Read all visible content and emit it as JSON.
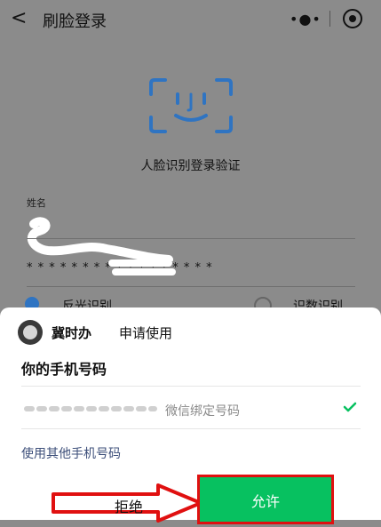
{
  "header": {
    "back_icon": "chevron-left-icon",
    "title": "刷脸登录",
    "more_icon": "more-dots-icon",
    "capture_icon": "capture-icon"
  },
  "main": {
    "face_icon": "face-scan-icon",
    "face_caption": "人脸识别登录验证",
    "name_label": "姓名",
    "password_mask": "* * * * * * * * * * * * * * * * *",
    "radio_left": "反光识别",
    "radio_right": "识数识别"
  },
  "sheet": {
    "app_name": "冀时办",
    "apply_text": "申请使用",
    "title": "你的手机号码",
    "phone_note": "微信绑定号码",
    "check_icon": "check-icon",
    "other_phone": "使用其他手机号码",
    "reject": "拒绝",
    "allow": "允许"
  },
  "colors": {
    "overlay_gray": "#8b8b8b",
    "face_blue": "#2f74c2",
    "allow_green": "#07c160",
    "highlight_red": "#e01010",
    "link_blue": "#3d4f7a"
  }
}
